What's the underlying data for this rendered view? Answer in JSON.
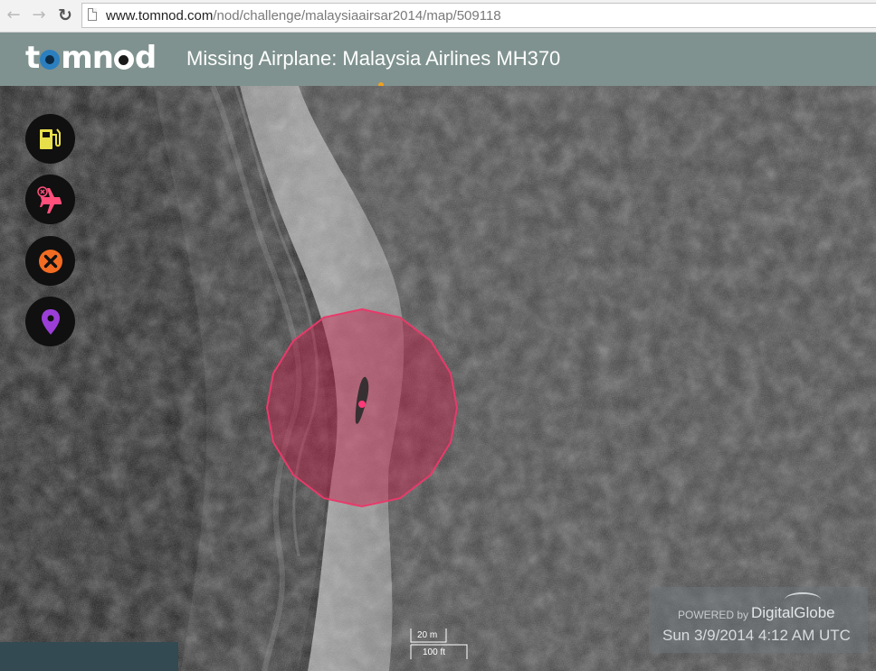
{
  "browser": {
    "url_host": "www.tomnod.com",
    "url_path": "/nod/challenge/malaysiaairsar2014/map/509118"
  },
  "header": {
    "logo_text": "tomnod",
    "title": "Missing Airplane: Malaysia Airlines MH370"
  },
  "tools": [
    {
      "icon": "fuel-pump-icon",
      "color": "#e8e04a"
    },
    {
      "icon": "plane-crossed-icon",
      "color": "#ff4f7b"
    },
    {
      "icon": "x-circle-icon",
      "color": "#f26b22"
    },
    {
      "icon": "map-pin-icon",
      "color": "#9b3ed8"
    }
  ],
  "scale": {
    "metric": "20 m",
    "imperial": "100 ft"
  },
  "attribution": {
    "powered": "POWERED by",
    "brand": "DigitalGlobe",
    "date": "Sun 3/9/2014 4:12 AM UTC"
  },
  "colors": {
    "header_bg": "#7f928f",
    "marker_fill": "#d02050"
  }
}
